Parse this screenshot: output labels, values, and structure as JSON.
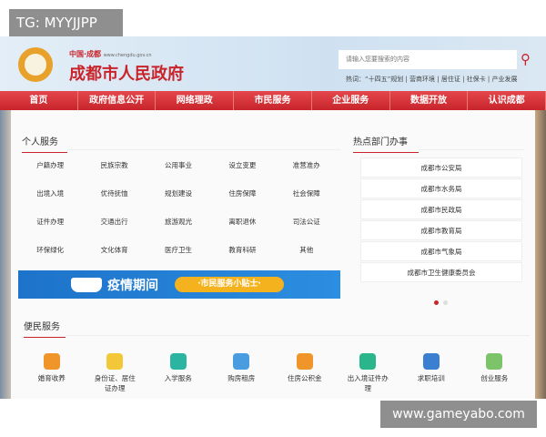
{
  "watermark_top": "TG: MYYJJPP",
  "watermark_bottom": "www.gameyabo.com",
  "header": {
    "site_small": "中国·成都",
    "site_url": "www.chengdu.gov.cn",
    "site_title": "成都市人民政府",
    "search_placeholder": "请输入您要搜索的内容",
    "hot_label": "热词：",
    "hot_words": "“十四五”规划 | 营商环境 | 居住证 | 社保卡 | 产业发展"
  },
  "nav": [
    "首页",
    "政府信息公开",
    "网络理政",
    "市民服务",
    "企业服务",
    "数据开放",
    "认识成都"
  ],
  "personal": {
    "title": "个人服务",
    "items": [
      "户籍办理",
      "民族宗教",
      "公用事业",
      "设立变更",
      "准营准办",
      "出境入境",
      "优待抚恤",
      "规划建设",
      "住房保障",
      "社会保障",
      "证件办理",
      "交通出行",
      "旅游观光",
      "离职退休",
      "司法公证",
      "环保绿化",
      "文化体育",
      "医疗卫生",
      "教育科研",
      "其他"
    ]
  },
  "banner": {
    "title": "疫情期间",
    "subtitle": "·市民服务小贴士·"
  },
  "hot_dept": {
    "title": "热点部门办事",
    "items": [
      "成都市公安局",
      "成都市水务局",
      "成都市民政局",
      "成都市教育局",
      "成都市气象局",
      "成都市卫生健康委员会"
    ]
  },
  "convenience": {
    "title": "便民服务",
    "items": [
      {
        "label": "婚育收养",
        "icon": "baby-icon",
        "color": "#f0952a"
      },
      {
        "label": "身份证、居住证办理",
        "icon": "id-card-icon",
        "color": "#f3c838"
      },
      {
        "label": "入学服务",
        "icon": "graduation-cap-icon",
        "color": "#2bb5a0"
      },
      {
        "label": "购房租房",
        "icon": "building-icon",
        "color": "#4a9ce0"
      },
      {
        "label": "住房公积金",
        "icon": "house-yuan-icon",
        "color": "#f0952a"
      },
      {
        "label": "出入境证件办理",
        "icon": "globe-plane-icon",
        "color": "#2bb58a"
      },
      {
        "label": "求职培训",
        "icon": "tie-icon",
        "color": "#3a7fd0"
      },
      {
        "label": "创业服务",
        "icon": "person-icon",
        "color": "#7cc36a"
      }
    ]
  },
  "colors": {
    "brand": "#c9242b",
    "accent_dot": "#c9242b"
  }
}
